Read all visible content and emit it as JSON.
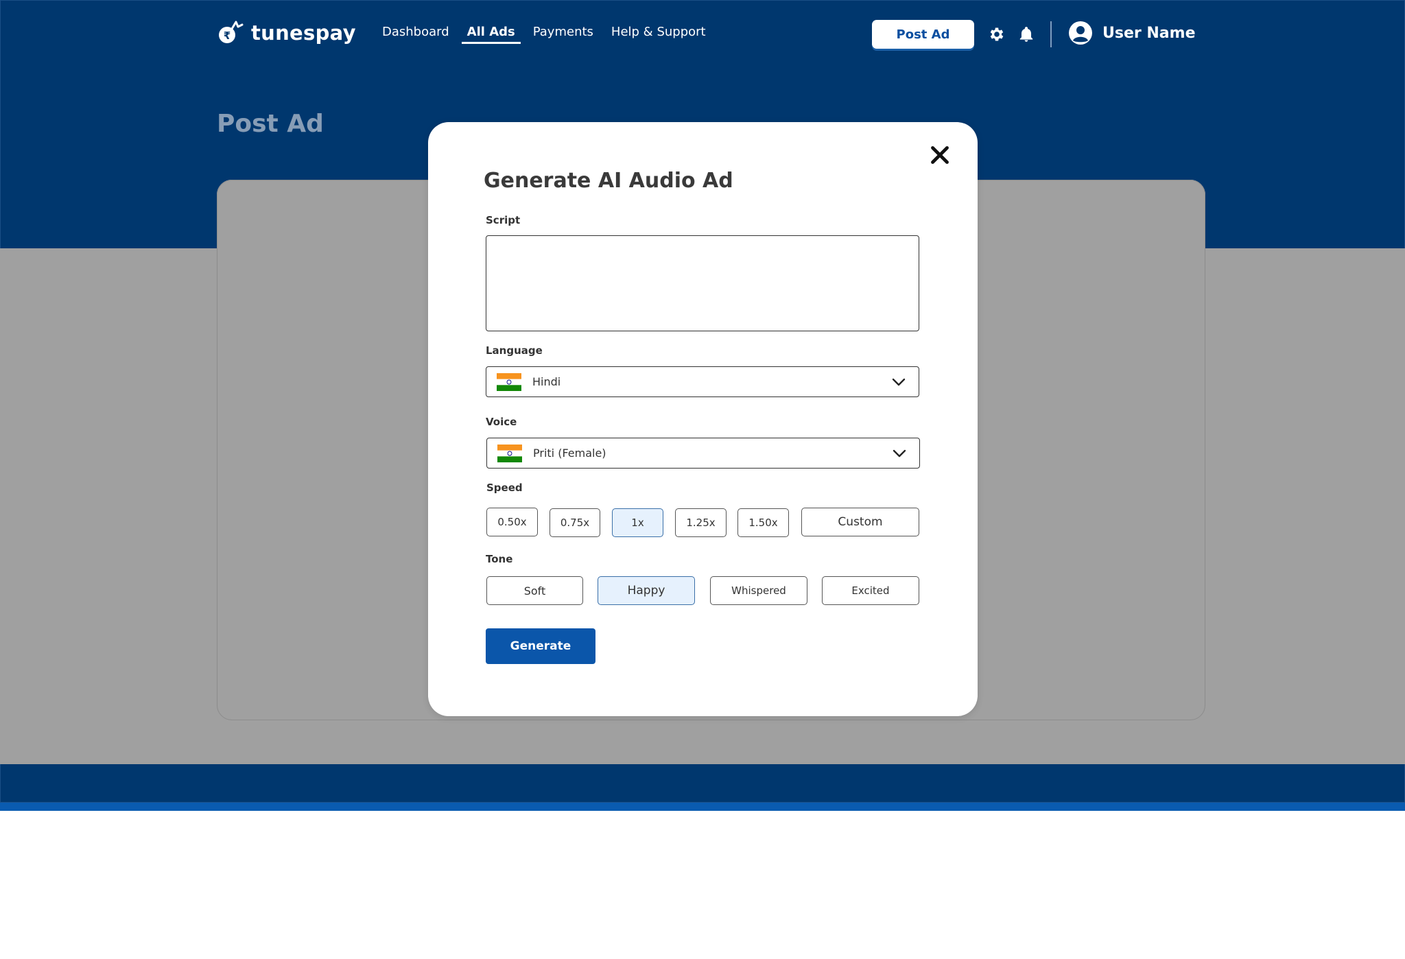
{
  "brand": {
    "name": "tunespay"
  },
  "nav": {
    "items": [
      {
        "label": "Dashboard",
        "active": false
      },
      {
        "label": "All Ads",
        "active": true
      },
      {
        "label": "Payments",
        "active": false
      },
      {
        "label": "Help & Support",
        "active": false
      }
    ]
  },
  "header": {
    "post_ad_label": "Post Ad",
    "settings_icon": "gear-icon",
    "notifications_icon": "bell-icon",
    "user_name": "User Name"
  },
  "page": {
    "title": "Post Ad"
  },
  "modal": {
    "title": "Generate AI Audio Ad",
    "script": {
      "label": "Script",
      "value": ""
    },
    "language": {
      "label": "Language",
      "value": "Hindi",
      "flag": "india-flag"
    },
    "voice": {
      "label": "Voice",
      "value": "Priti (Female)",
      "flag": "india-flag"
    },
    "speed": {
      "label": "Speed",
      "options": [
        "0.50x",
        "0.75x",
        "1x",
        "1.25x",
        "1.50x",
        "Custom"
      ],
      "selected": "1x"
    },
    "tone": {
      "label": "Tone",
      "options": [
        "Soft",
        "Happy",
        "Whispered",
        "Excited"
      ],
      "selected": "Happy"
    },
    "generate_label": "Generate"
  },
  "colors": {
    "navy": "#00376e",
    "primary": "#0b56aa",
    "selected_chip": "#e6f1fd"
  }
}
